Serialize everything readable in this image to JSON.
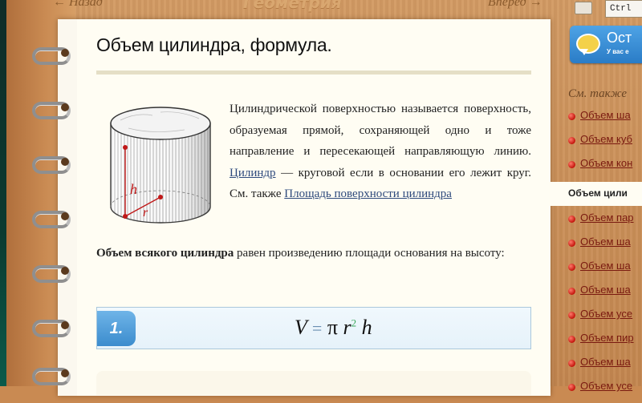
{
  "nav": {
    "back": "← Назад",
    "title": "Геометрия",
    "forward": "Вперед →"
  },
  "toolbar": {
    "keyboard_icon": "keyboard-icon",
    "ctrl_hint": "Ctrl"
  },
  "ask": {
    "label": "Ост",
    "sub": "У вас е"
  },
  "article": {
    "title": "Объем цилиндра, формула.",
    "desc_prefix": "Цилиндрической поверхностью называется поверхность, образуемая прямой, сохраняющей одно и тоже направление и пересекающей направляющую линию.",
    "cylinder_link": "Цилиндр",
    "desc_mid": "— круговой если в основании его лежит круг. См. также",
    "surface_link": "Площадь поверхности цилиндра",
    "vol_bold": "Объем всякого цилиндра",
    "vol_rest": "равен произведению площади основания на высоту:",
    "figure_labels": {
      "h": "h",
      "r": "r"
    },
    "formula": {
      "number": "1.",
      "V": "V",
      "eq": "=",
      "pi": "π",
      "r": "r",
      "exp": "2",
      "h": "h"
    }
  },
  "sidebar": {
    "see_also": "См. также",
    "links_before": [
      "Объем ша",
      "Объем куб",
      "Объем кон"
    ],
    "active": "Объем цили",
    "links_after": [
      "Объем пар",
      "Объем ша",
      "Объем ша",
      "Объем ша",
      "Объем усе",
      "Объем пир",
      "Объем ша",
      "Объем усе"
    ]
  }
}
